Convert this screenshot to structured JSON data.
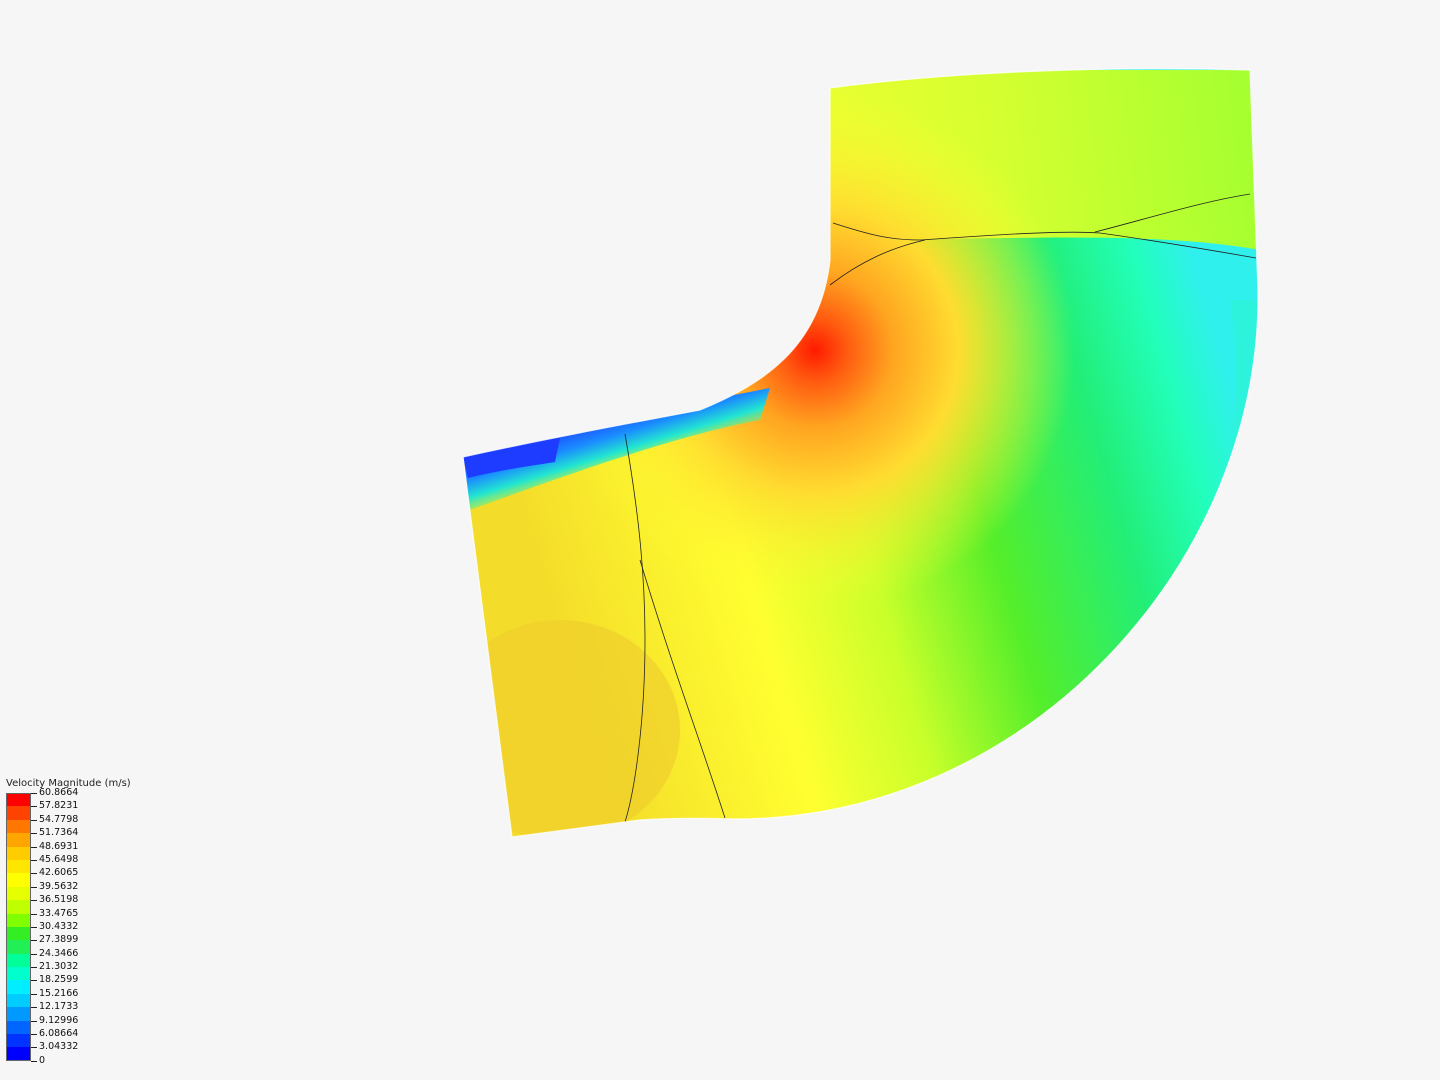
{
  "legend": {
    "title": "Velocity Magnitude (m/s)",
    "ticks": [
      "60.8664",
      "57.8231",
      "54.7798",
      "51.7364",
      "48.6931",
      "45.6498",
      "42.6065",
      "39.5632",
      "36.5198",
      "33.4765",
      "30.4332",
      "27.3899",
      "24.3466",
      "21.3032",
      "18.2599",
      "15.2166",
      "12.1733",
      "9.12996",
      "6.08664",
      "3.04332",
      "0"
    ],
    "colors": [
      "#ff0000",
      "#fe4200",
      "#ff7600",
      "#ffa500",
      "#ffcc00",
      "#ffe600",
      "#ffff00",
      "#e6ff00",
      "#bfff00",
      "#7fff00",
      "#33ee22",
      "#22ee55",
      "#00ff99",
      "#00ffcc",
      "#00eeff",
      "#00ccff",
      "#0099ff",
      "#0066ff",
      "#0033ff",
      "#0000ff"
    ]
  },
  "colors": {
    "background": "#f6f6f6",
    "mesh_lines": "#222222"
  }
}
